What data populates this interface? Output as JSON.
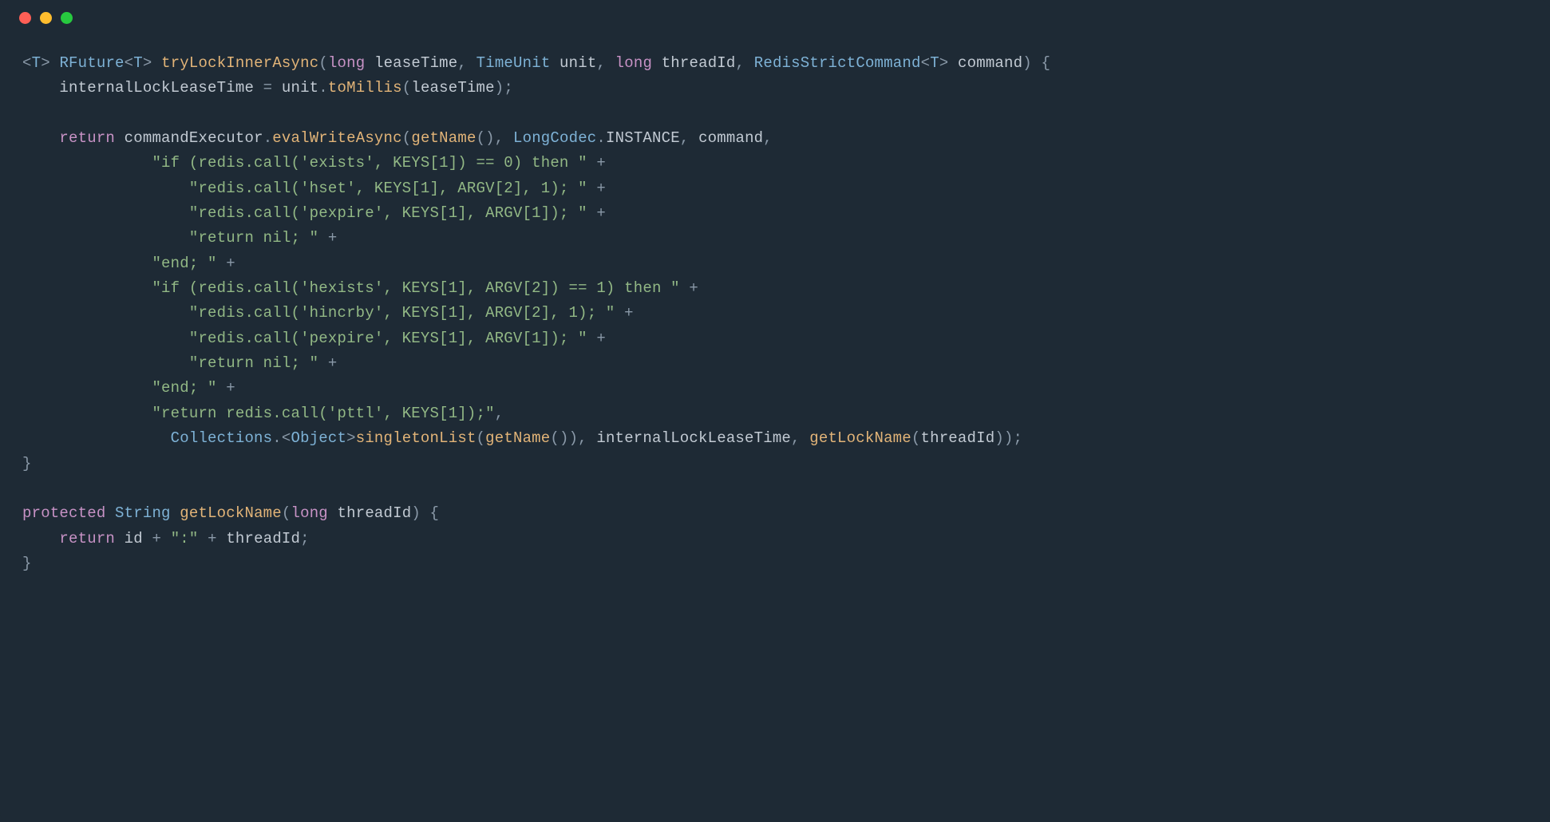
{
  "tokens": [
    {
      "c": "t-punc",
      "t": "<"
    },
    {
      "c": "t-type",
      "t": "T"
    },
    {
      "c": "t-punc",
      "t": "> "
    },
    {
      "c": "t-type",
      "t": "RFuture"
    },
    {
      "c": "t-punc",
      "t": "<"
    },
    {
      "c": "t-type",
      "t": "T"
    },
    {
      "c": "t-punc",
      "t": "> "
    },
    {
      "c": "t-method",
      "t": "tryLockInnerAsync"
    },
    {
      "c": "t-punc",
      "t": "("
    },
    {
      "c": "t-kw",
      "t": "long"
    },
    {
      "c": "t-var",
      "t": " leaseTime"
    },
    {
      "c": "t-punc",
      "t": ", "
    },
    {
      "c": "t-type",
      "t": "TimeUnit"
    },
    {
      "c": "t-var",
      "t": " unit"
    },
    {
      "c": "t-punc",
      "t": ", "
    },
    {
      "c": "t-kw",
      "t": "long"
    },
    {
      "c": "t-var",
      "t": " threadId"
    },
    {
      "c": "t-punc",
      "t": ", "
    },
    {
      "c": "t-type",
      "t": "RedisStrictCommand"
    },
    {
      "c": "t-punc",
      "t": "<"
    },
    {
      "c": "t-type",
      "t": "T"
    },
    {
      "c": "t-punc",
      "t": "> "
    },
    {
      "c": "t-var",
      "t": "command"
    },
    {
      "c": "t-punc",
      "t": ") {"
    },
    {
      "nl": true
    },
    {
      "c": "t-var",
      "t": "    internalLockLeaseTime "
    },
    {
      "c": "t-op",
      "t": "= "
    },
    {
      "c": "t-var",
      "t": "unit"
    },
    {
      "c": "t-punc",
      "t": "."
    },
    {
      "c": "t-method",
      "t": "toMillis"
    },
    {
      "c": "t-punc",
      "t": "("
    },
    {
      "c": "t-var",
      "t": "leaseTime"
    },
    {
      "c": "t-punc",
      "t": ");"
    },
    {
      "nl": true
    },
    {
      "nl": true
    },
    {
      "c": "t-var",
      "t": "    "
    },
    {
      "c": "t-kw",
      "t": "return"
    },
    {
      "c": "t-var",
      "t": " commandExecutor"
    },
    {
      "c": "t-punc",
      "t": "."
    },
    {
      "c": "t-method",
      "t": "evalWriteAsync"
    },
    {
      "c": "t-punc",
      "t": "("
    },
    {
      "c": "t-method",
      "t": "getName"
    },
    {
      "c": "t-punc",
      "t": "(), "
    },
    {
      "c": "t-type",
      "t": "LongCodec"
    },
    {
      "c": "t-punc",
      "t": "."
    },
    {
      "c": "t-const",
      "t": "INSTANCE"
    },
    {
      "c": "t-punc",
      "t": ", "
    },
    {
      "c": "t-var",
      "t": "command"
    },
    {
      "c": "t-punc",
      "t": ","
    },
    {
      "nl": true
    },
    {
      "c": "t-var",
      "t": "              "
    },
    {
      "c": "t-str",
      "t": "\"if (redis.call('exists', KEYS[1]) == 0) then \""
    },
    {
      "c": "t-op",
      "t": " +"
    },
    {
      "nl": true
    },
    {
      "c": "t-var",
      "t": "                  "
    },
    {
      "c": "t-str",
      "t": "\"redis.call('hset', KEYS[1], ARGV[2], 1); \""
    },
    {
      "c": "t-op",
      "t": " +"
    },
    {
      "nl": true
    },
    {
      "c": "t-var",
      "t": "                  "
    },
    {
      "c": "t-str",
      "t": "\"redis.call('pexpire', KEYS[1], ARGV[1]); \""
    },
    {
      "c": "t-op",
      "t": " +"
    },
    {
      "nl": true
    },
    {
      "c": "t-var",
      "t": "                  "
    },
    {
      "c": "t-str",
      "t": "\"return nil; \""
    },
    {
      "c": "t-op",
      "t": " +"
    },
    {
      "nl": true
    },
    {
      "c": "t-var",
      "t": "              "
    },
    {
      "c": "t-str",
      "t": "\"end; \""
    },
    {
      "c": "t-op",
      "t": " +"
    },
    {
      "nl": true
    },
    {
      "c": "t-var",
      "t": "              "
    },
    {
      "c": "t-str",
      "t": "\"if (redis.call('hexists', KEYS[1], ARGV[2]) == 1) then \""
    },
    {
      "c": "t-op",
      "t": " +"
    },
    {
      "nl": true
    },
    {
      "c": "t-var",
      "t": "                  "
    },
    {
      "c": "t-str",
      "t": "\"redis.call('hincrby', KEYS[1], ARGV[2], 1); \""
    },
    {
      "c": "t-op",
      "t": " +"
    },
    {
      "nl": true
    },
    {
      "c": "t-var",
      "t": "                  "
    },
    {
      "c": "t-str",
      "t": "\"redis.call('pexpire', KEYS[1], ARGV[1]); \""
    },
    {
      "c": "t-op",
      "t": " +"
    },
    {
      "nl": true
    },
    {
      "c": "t-var",
      "t": "                  "
    },
    {
      "c": "t-str",
      "t": "\"return nil; \""
    },
    {
      "c": "t-op",
      "t": " +"
    },
    {
      "nl": true
    },
    {
      "c": "t-var",
      "t": "              "
    },
    {
      "c": "t-str",
      "t": "\"end; \""
    },
    {
      "c": "t-op",
      "t": " +"
    },
    {
      "nl": true
    },
    {
      "c": "t-var",
      "t": "              "
    },
    {
      "c": "t-str",
      "t": "\"return redis.call('pttl', KEYS[1]);\""
    },
    {
      "c": "t-punc",
      "t": ","
    },
    {
      "nl": true
    },
    {
      "c": "t-var",
      "t": "                "
    },
    {
      "c": "t-type",
      "t": "Collections"
    },
    {
      "c": "t-punc",
      "t": ".<"
    },
    {
      "c": "t-type",
      "t": "Object"
    },
    {
      "c": "t-punc",
      "t": ">"
    },
    {
      "c": "t-method",
      "t": "singletonList"
    },
    {
      "c": "t-punc",
      "t": "("
    },
    {
      "c": "t-method",
      "t": "getName"
    },
    {
      "c": "t-punc",
      "t": "()), "
    },
    {
      "c": "t-var",
      "t": "internalLockLeaseTime"
    },
    {
      "c": "t-punc",
      "t": ", "
    },
    {
      "c": "t-method",
      "t": "getLockName"
    },
    {
      "c": "t-punc",
      "t": "("
    },
    {
      "c": "t-var",
      "t": "threadId"
    },
    {
      "c": "t-punc",
      "t": "));"
    },
    {
      "nl": true
    },
    {
      "c": "t-punc",
      "t": "}"
    },
    {
      "nl": true
    },
    {
      "nl": true
    },
    {
      "c": "t-kw",
      "t": "protected"
    },
    {
      "c": "t-var",
      "t": " "
    },
    {
      "c": "t-type",
      "t": "String"
    },
    {
      "c": "t-var",
      "t": " "
    },
    {
      "c": "t-method",
      "t": "getLockName"
    },
    {
      "c": "t-punc",
      "t": "("
    },
    {
      "c": "t-kw",
      "t": "long"
    },
    {
      "c": "t-var",
      "t": " threadId"
    },
    {
      "c": "t-punc",
      "t": ") {"
    },
    {
      "nl": true
    },
    {
      "c": "t-var",
      "t": "    "
    },
    {
      "c": "t-kw",
      "t": "return"
    },
    {
      "c": "t-var",
      "t": " id "
    },
    {
      "c": "t-op",
      "t": "+ "
    },
    {
      "c": "t-str",
      "t": "\":\""
    },
    {
      "c": "t-op",
      "t": " + "
    },
    {
      "c": "t-var",
      "t": "threadId"
    },
    {
      "c": "t-punc",
      "t": ";"
    },
    {
      "nl": true
    },
    {
      "c": "t-punc",
      "t": "}"
    }
  ]
}
